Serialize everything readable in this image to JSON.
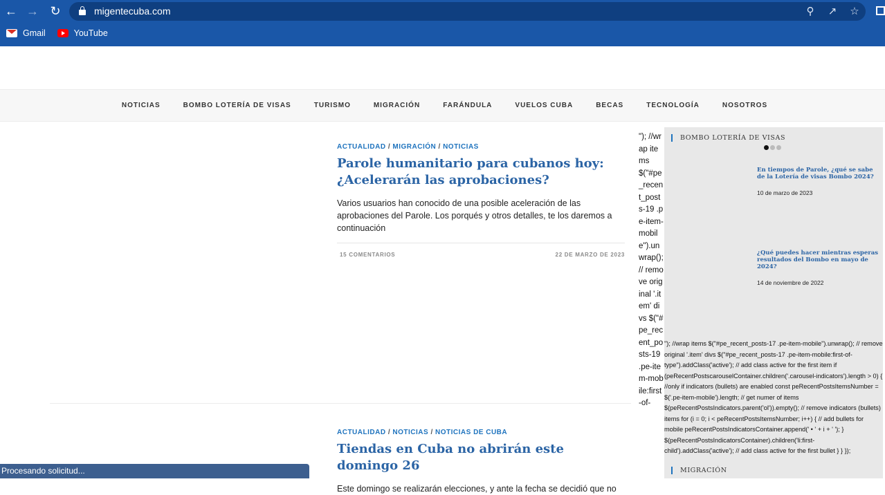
{
  "browser": {
    "url": "migentecuba.com",
    "bookmarks": [
      {
        "label": "Gmail",
        "icon": "gmail-icon"
      },
      {
        "label": "YouTube",
        "icon": "youtube-icon"
      }
    ],
    "status": "Procesando solicitud..."
  },
  "nav": {
    "items": [
      "NOTICIAS",
      "BOMBO LOTERÍA DE VISAS",
      "TURISMO",
      "MIGRACIÓN",
      "FARÁNDULA",
      "VUELOS CUBA",
      "BECAS",
      "TECNOLOGÍA",
      "NOSOTROS"
    ]
  },
  "articles": [
    {
      "categories": [
        "ACTUALIDAD",
        "MIGRACIÓN",
        "NOTICIAS"
      ],
      "title": "Parole humanitario para cubanos hoy: ¿Acelerarán las aprobaciones?",
      "excerpt": "Varios usuarios han conocido de una posible aceleración de las aprobaciones del Parole. Los porqués y otros detalles, te los daremos a continuación",
      "comments": "15 COMENTARIOS",
      "date": "22 DE MARZO DE 2023"
    },
    {
      "categories": [
        "ACTUALIDAD",
        "NOTICIAS",
        "NOTICIAS DE CUBA"
      ],
      "title": "Tiendas en Cuba no abrirán este domingo 26",
      "excerpt": "Este domingo se realizarán elecciones, y ante la fecha se decidió que no"
    }
  ],
  "code_column": "\"); //wrap items $(\"#pe_recent_posts-19 .pe-item-mobile\").unwrap(); // remove original '.item' divs $(\"#pe_recent_posts-19 .pe-item-mobile:first-of-",
  "sidebar": {
    "widget_title": "BOMBO LOTERÍA DE VISAS",
    "posts": [
      {
        "title": "En tiempos de Parole, ¿qué se sabe de la Lotería de visas Bombo 2024?",
        "date": "10 de marzo de 2023"
      },
      {
        "title": "¿Qué puedes hacer mientras esperas resultados del Bombo en mayo de 2024?",
        "date": "14 de noviembre de 2022"
      }
    ],
    "code_text": "\"); //wrap items $(\"#pe_recent_posts-17 .pe-item-mobile\").unwrap(); // remove original '.item' divs $(\"#pe_recent_posts-17 .pe-item-mobile:first-of-type\").addClass('active'); // add class active for the first item if (peRecentPostscarouselContainer.children('.carousel-indicators').length > 0) { //only if indicators (bullets) are enabled const peRecentPostsItemsNumber = $('.pe-item-mobile').length; // get numer of items $(peRecentPostsIndicators.parent('ol')).empty(); // remove indicators (bullets) items for (i = 0; i < peRecentPostsItemsNumber; i++) { // add bullets for mobile peRecentPostsIndicatorsContainer.append(' • ' + i + ' '); } $(peRecentPostsIndicatorsContainer).children('li:first-child').addClass('active'); // add class active for the first bullet } } });",
    "widget2_title": "MIGRACIÓN"
  }
}
